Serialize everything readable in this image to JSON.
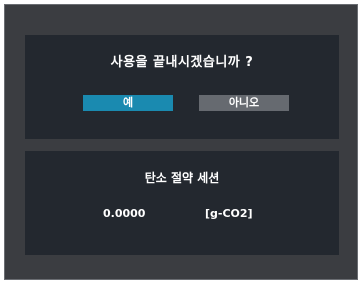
{
  "dialog": {
    "question": "사용을 끝내시겠습니까 ?",
    "yes_label": "예",
    "no_label": "아니오"
  },
  "co2": {
    "title": "탄소 절약 세션",
    "value": "0.0000",
    "unit": "[g-CO2]"
  },
  "colors": {
    "selected_button": "#1a8ab0",
    "unselected_button": "#666a70",
    "panel_bg": "#23282f",
    "screen_bg": "#3b3d41"
  }
}
